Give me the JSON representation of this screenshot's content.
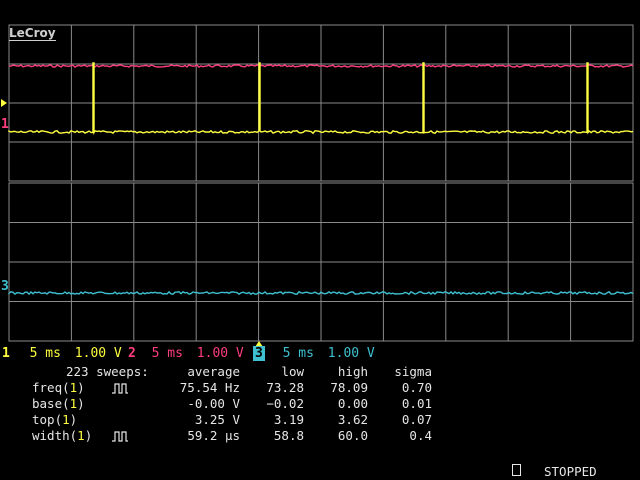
{
  "brand": "LeCroy",
  "colors": {
    "grid": "#8a8a8a",
    "ch1": "#ffff40",
    "ch2": "#ff3d7f",
    "ch3": "#3ec0d0",
    "text": "#e6e6e6"
  },
  "channels": [
    {
      "num": "1",
      "timebase": "5 ms",
      "volts": "1.00 V"
    },
    {
      "num": "2",
      "timebase": "5 ms",
      "volts": "1.00 V"
    },
    {
      "num": "3",
      "timebase": "5 ms",
      "volts": "1.00 V"
    }
  ],
  "trace_markers": {
    "ch1": "1",
    "ch3": "3"
  },
  "measurements": {
    "sweeps_label": "223 sweeps:",
    "headers": {
      "average": "average",
      "low": "low",
      "high": "high",
      "sigma": "sigma"
    },
    "rows": [
      {
        "name": "freq(",
        "ch": "1",
        "close": ")",
        "icon": "pulse-icon",
        "average": "75.54 Hz",
        "low": "73.28",
        "high": "78.09",
        "sigma": "0.70"
      },
      {
        "name": "base(",
        "ch": "1",
        "close": ")",
        "icon": "",
        "average": "-0.00 V",
        "low": "−0.02",
        "high": "0.00",
        "sigma": "0.01"
      },
      {
        "name": "top(",
        "ch": "1",
        "close": ")",
        "icon": "",
        "average": "3.25 V",
        "low": "3.19",
        "high": "3.62",
        "sigma": "0.07"
      },
      {
        "name": "width(",
        "ch": "1",
        "close": ")",
        "icon": "pulse-icon",
        "average": "59.2 µs",
        "low": "58.8",
        "high": "60.0",
        "sigma": "0.4"
      }
    ]
  },
  "status": "STOPPED"
}
